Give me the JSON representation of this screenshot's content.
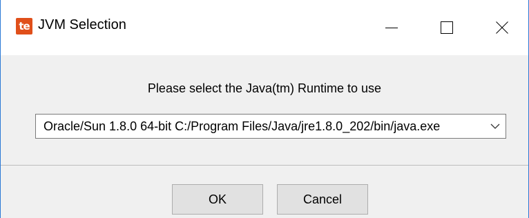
{
  "window": {
    "title": "JVM Selection",
    "app_icon_text": "te",
    "app_icon_color": "#e04f1a",
    "title_bar_buttons": [
      "minimize-icon",
      "maximize-icon",
      "close-icon"
    ]
  },
  "dialog": {
    "prompt": "Please select the Java(tm) Runtime to use",
    "jvm_select": {
      "selected": "Oracle/Sun 1.8.0 64-bit C:/Program Files/Java/jre1.8.0_202/bin/java.exe"
    },
    "buttons": {
      "ok_label": "OK",
      "cancel_label": "Cancel"
    }
  }
}
